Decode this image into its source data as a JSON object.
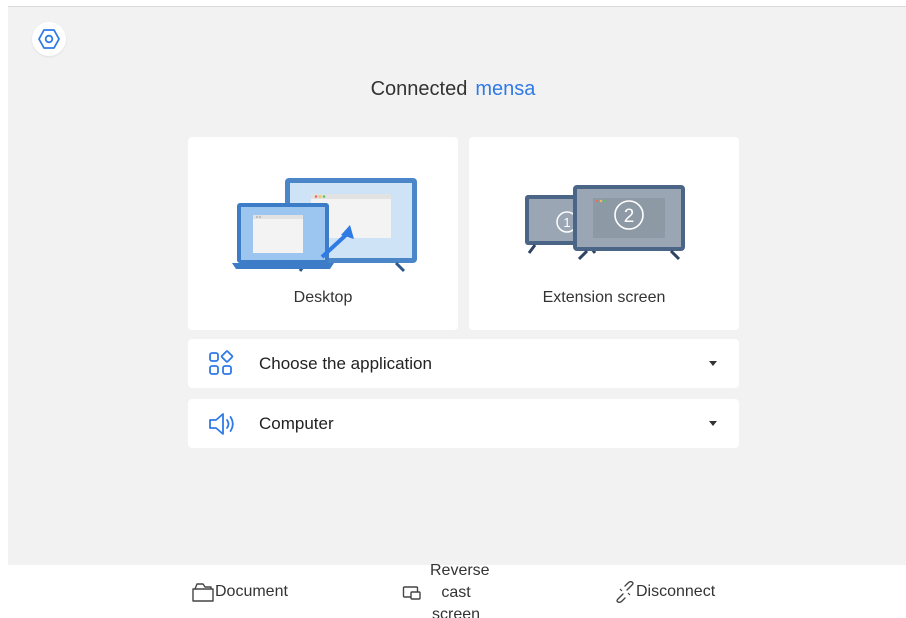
{
  "header": {
    "settings_icon": "hexagon-settings-icon"
  },
  "connection": {
    "status_label": "Connected",
    "device_name": "mensa",
    "accent_color": "#2f7ae5"
  },
  "modes": [
    {
      "label": "Desktop",
      "icon": "laptop-to-monitor-icon"
    },
    {
      "label": "Extension screen",
      "icon": "dual-monitor-icon"
    }
  ],
  "app_select": {
    "label": "Choose the application",
    "icon": "apps-grid-icon"
  },
  "audio_select": {
    "label": "Computer",
    "icon": "speaker-icon"
  },
  "bottom_bar": {
    "document": "Document",
    "reverse_cast": "Reverse cast screen",
    "disconnect": "Disconnect"
  }
}
